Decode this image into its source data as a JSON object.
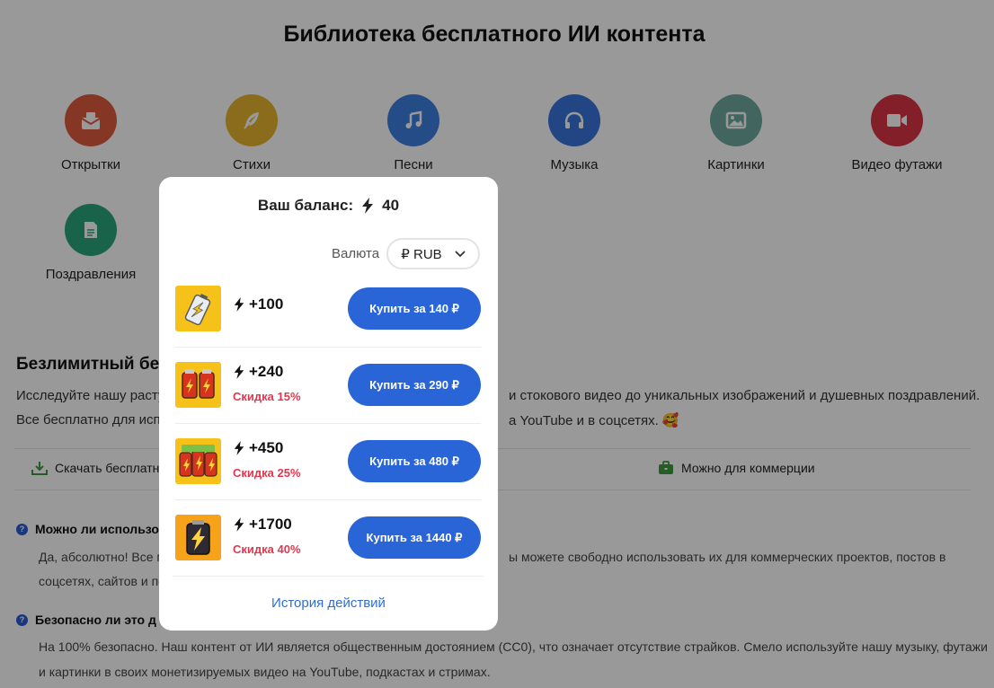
{
  "page": {
    "title": "Библиотека бесплатного ИИ контента",
    "categories": [
      {
        "label": "Открытки",
        "color": "#e05a3f",
        "icon": "postcard-icon"
      },
      {
        "label": "Стихи",
        "color": "#e7b52f",
        "icon": "feather-icon"
      },
      {
        "label": "Песни",
        "color": "#3d7fe0",
        "icon": "music-note-icon"
      },
      {
        "label": "Музыка",
        "color": "#3a73dc",
        "icon": "headphones-icon"
      },
      {
        "label": "Картинки",
        "color": "#6ea8a0",
        "icon": "image-icon"
      },
      {
        "label": "Видео футажи",
        "color": "#d93444",
        "icon": "video-camera-icon"
      },
      {
        "label": "Поздравления",
        "color": "#2aa57d",
        "icon": "document-icon"
      }
    ],
    "section_title": "Безлимитный бес",
    "para1_left": "Исследуйте нашу расту",
    "para1_right": "и стокового видео до уникальных изображений и душевных поздравлений.",
    "para2_left": "Все бесплатно для исп",
    "para2_right": "а YouTube и в соцсетях. 🥰",
    "feature_download": "Скачать бесплатно",
    "feature_commerce": "Можно для коммерции",
    "faq1_q": "Можно ли использо",
    "faq1_a_line1_left": "Да, абсолютно! Все м",
    "faq1_a_line1_right": "ы можете свободно использовать их для коммерческих проектов, постов в",
    "faq1_a_line2": "соцсетях, сайтов и пе",
    "faq2_q": "Безопасно ли это д",
    "faq2_a_line1": "На 100% безопасно. Наш контент от ИИ является общественным достоянием (CC0), что означает отсутствие страйков. Смело используйте нашу музыку, футажи",
    "faq2_a_line2": "и картинки в своих монетизируемых видео на YouTube, подкастах и стримах."
  },
  "modal": {
    "balance_label": "Ваш баланс:",
    "balance_value": "40",
    "currency_label": "Валюта",
    "currency_value": "₽ RUB",
    "packages": [
      {
        "amount": "+100",
        "discount": "",
        "buy": "Купить за 140 ₽"
      },
      {
        "amount": "+240",
        "discount": "Скидка 15%",
        "buy": "Купить за 290 ₽"
      },
      {
        "amount": "+450",
        "discount": "Скидка 25%",
        "buy": "Купить за 480 ₽"
      },
      {
        "amount": "+1700",
        "discount": "Скидка 40%",
        "buy": "Купить за 1440 ₽"
      }
    ],
    "history_link": "История действий"
  }
}
